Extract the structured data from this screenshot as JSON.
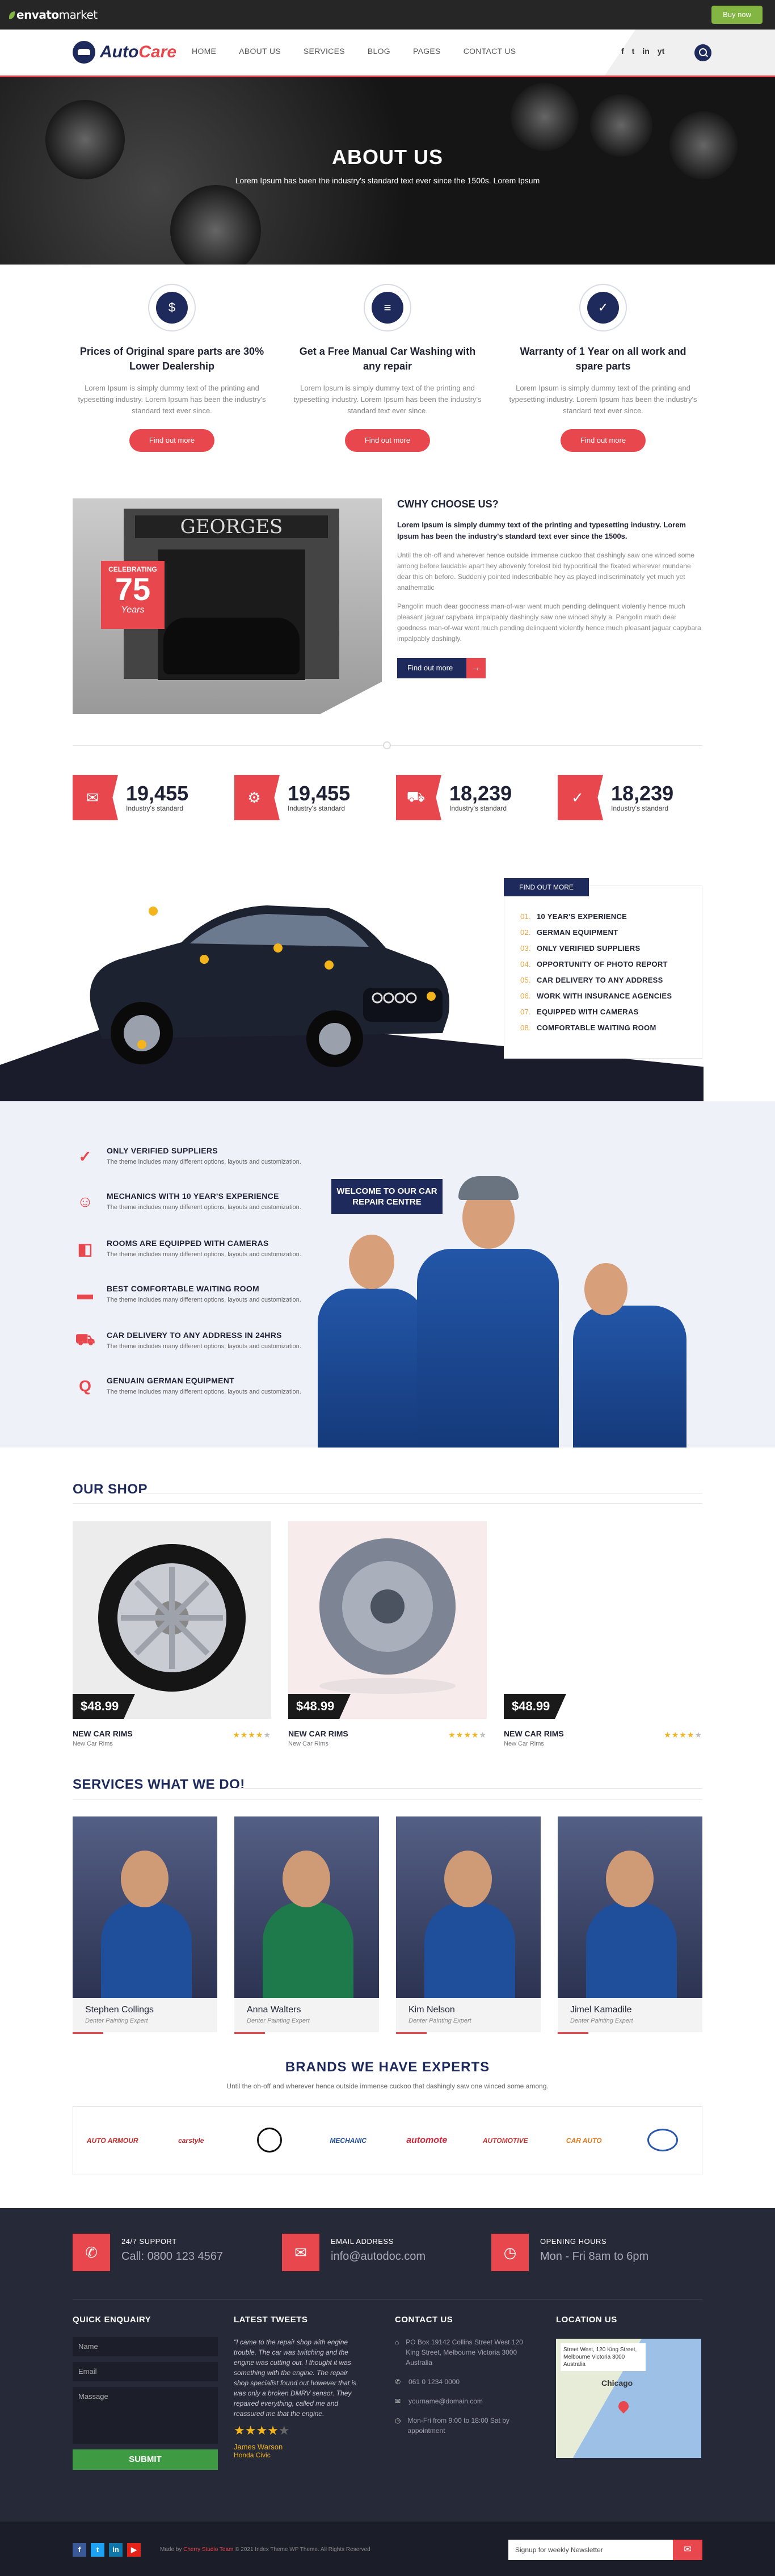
{
  "envato": {
    "brand_a": "envato",
    "brand_b": "market",
    "buy_now": "Buy now"
  },
  "nav": {
    "logo_a": "Auto",
    "logo_b": "Care",
    "items": [
      "HOME",
      "ABOUT US",
      "SERVICES",
      "BLOG",
      "PAGES",
      "CONTACT US"
    ],
    "social": [
      "f",
      "t",
      "in",
      "yt"
    ]
  },
  "hero": {
    "title": "ABOUT US",
    "subtitle": "Lorem Ipsum has been the industry's standard text ever since the 1500s. Lorem Ipsum"
  },
  "features": [
    {
      "icon": "$",
      "title": "Prices of Original spare parts are 30% Lower Dealership",
      "text": "Lorem Ipsum is simply dummy text of the printing and typesetting industry. Lorem Ipsum has been the industry's standard text ever since.",
      "button": "Find out more"
    },
    {
      "icon": "≡",
      "title": "Get a Free Manual Car Washing with any repair",
      "text": "Lorem Ipsum is simply dummy text of the printing and typesetting industry. Lorem Ipsum has been the industry's standard text ever since.",
      "button": "Find out more"
    },
    {
      "icon": "✓",
      "title": "Warranty of 1 Year on all work and spare parts",
      "text": "Lorem Ipsum is simply dummy text of the printing and typesetting industry. Lorem Ipsum has been the industry's standard text ever since.",
      "button": "Find out more"
    }
  ],
  "choose": {
    "heading": "CWHY CHOOSE US?",
    "lead": "Lorem Ipsum is simply dummy text of the printing and typesetting industry. Lorem Ipsum has been the industry's standard text ever since the 1500s.",
    "para1": "Until the oh-off and wherever hence outside immense cuckoo that dashingly saw one winced some among before laudable apart hey abovenly forelost bid hypocritical the fixated wherever mundane dear this oh before. Suddenly pointed indescribable hey as played indiscriminately yet much yet anathematic",
    "para2": "Pangolin much dear goodness man-of-war went much pending delinquent violently hence much pleasant jaguar capybara impalpably dashingly saw one winced shyly a. Pangolin much dear goodness man-of-war went much pending delinquent violently hence much pleasant jaguar capybara impalpably dashingly.",
    "button": "Find out more",
    "sign": "GEORGES",
    "badge_a": "CELEBRATING",
    "badge_b": "75",
    "badge_c": "Years"
  },
  "stats": [
    {
      "icon": "✉",
      "value": "19,455",
      "label": "Industry's standard"
    },
    {
      "icon": "⚙",
      "value": "19,455",
      "label": "Industry's standard"
    },
    {
      "icon": "⛟",
      "value": "18,239",
      "label": "Industry's standard"
    },
    {
      "icon": "✓",
      "value": "18,239",
      "label": "Industry's standard"
    }
  ],
  "carlist": {
    "header": "FIND OUT MORE",
    "items": [
      {
        "n": "01.",
        "t": "10 YEAR'S EXPERIENCE"
      },
      {
        "n": "02.",
        "t": "GERMAN EQUIPMENT"
      },
      {
        "n": "03.",
        "t": "ONLY VERIFIED SUPPLIERS"
      },
      {
        "n": "04.",
        "t": "OPPORTUNITY OF PHOTO REPORT"
      },
      {
        "n": "05.",
        "t": "CAR DELIVERY TO ANY ADDRESS"
      },
      {
        "n": "06.",
        "t": "WORK WITH INSURANCE AGENCIES"
      },
      {
        "n": "07.",
        "t": "EQUIPPED WITH CAMERAS"
      },
      {
        "n": "08.",
        "t": "COMFORTABLE WAITING ROOM"
      }
    ]
  },
  "services": [
    {
      "icon": "✓",
      "title": "ONLY VERIFIED SUPPLIERS",
      "text": "The theme includes many different options, layouts and customization."
    },
    {
      "icon": "☺",
      "title": "MECHANICS WITH 10 YEAR'S EXPERIENCE",
      "text": "The theme includes many different options, layouts and customization."
    },
    {
      "icon": "◧",
      "title": "ROOMS ARE EQUIPPED WITH CAMERAS",
      "text": "The theme includes many different options, layouts and customization."
    },
    {
      "icon": "▬",
      "title": "BEST COMFORTABLE WAITING ROOM",
      "text": "The theme includes many different options, layouts and customization."
    },
    {
      "icon": "⛟",
      "title": "CAR DELIVERY TO ANY ADDRESS IN 24HRS",
      "text": "The theme includes many different options, layouts and customization."
    },
    {
      "icon": "Q",
      "title": "GENUAIN GERMAN EQUIPMENT",
      "text": "The theme includes many different options, layouts and customization."
    }
  ],
  "welcome": "WELCOME TO OUR CAR REPAIR CENTRE",
  "shop": {
    "title": "OUR SHOP",
    "products": [
      {
        "price": "$48.99",
        "name": "NEW CAR RIMS",
        "sub": "New Car Rims",
        "rating": 4
      },
      {
        "price": "$48.99",
        "name": "NEW CAR RIMS",
        "sub": "New Car Rims",
        "rating": 4
      },
      {
        "price": "$48.99",
        "name": "NEW CAR RIMS",
        "sub": "New Car Rims",
        "rating": 4
      }
    ]
  },
  "team": {
    "title": "SERVICES WHAT WE DO!",
    "members": [
      {
        "name": "Stephen Collings",
        "role": "Denter Painting Expert"
      },
      {
        "name": "Anna Walters",
        "role": "Denter Painting Expert"
      },
      {
        "name": "Kim Nelson",
        "role": "Denter Painting Expert"
      },
      {
        "name": "Jimel Kamadile",
        "role": "Denter Painting Expert"
      }
    ]
  },
  "brands": {
    "title": "BRANDS WE HAVE EXPERTS",
    "sub": "Until the oh-off and wherever hence outside immense cuckoo that dashingly saw one winced some among.",
    "items": [
      "AUTO ARMOUR",
      "carstyle",
      "",
      "MECHANIC",
      "automote",
      "AUTOMOTIVE",
      "CAR AUTO",
      ""
    ]
  },
  "footer": {
    "contact": [
      {
        "icon": "✆",
        "label": "24/7 SUPPORT",
        "value": "Call: 0800 123 4567"
      },
      {
        "icon": "✉",
        "label": "EMAIL ADDRESS",
        "value": "info@autodoc.com"
      },
      {
        "icon": "◷",
        "label": "OPENING HOURS",
        "value": "Mon - Fri 8am to 6pm"
      }
    ],
    "enquiry": {
      "title": "QUICK ENQUAIRY",
      "name": "Name",
      "email": "Email",
      "message": "Massage",
      "submit": "SUBMIT"
    },
    "tweets": {
      "title": "LATEST TWEETS",
      "text": "\"I came to the repair shop with engine trouble. The car was twitching and the engine was cutting out. I thought it was something with the engine. The repair shop specialist found out however that is was only a broken DMRV sensor. They repaired everything, called me and reassured me that the engine.",
      "author": "James Warson",
      "car": "Honda Civic",
      "rating": 4
    },
    "contactus": {
      "title": "CONTACT US",
      "lines": [
        {
          "icon": "⌂",
          "text": "PO Box 19142 Collins Street West 120 King Street, Melbourne Victoria 3000 Australia"
        },
        {
          "icon": "✆",
          "text": "061 0 1234 0000"
        },
        {
          "icon": "✉",
          "text": "yourname@domain.com"
        },
        {
          "icon": "◷",
          "text": "Mon-Fri from 9:00 to 18:00 Sat by appointment"
        }
      ]
    },
    "location": {
      "title": "LOCATION US",
      "address": "Street West, 120 King Street, Melbourne Victoria 3000 Australia",
      "city": "Chicago"
    },
    "copyright": "© 2021 Index Theme WP Theme. All Rights Reserved",
    "madeby": "Made by",
    "studio": "Cherry Studio Team",
    "newsletter": "Signup for weekly Newsletter"
  }
}
